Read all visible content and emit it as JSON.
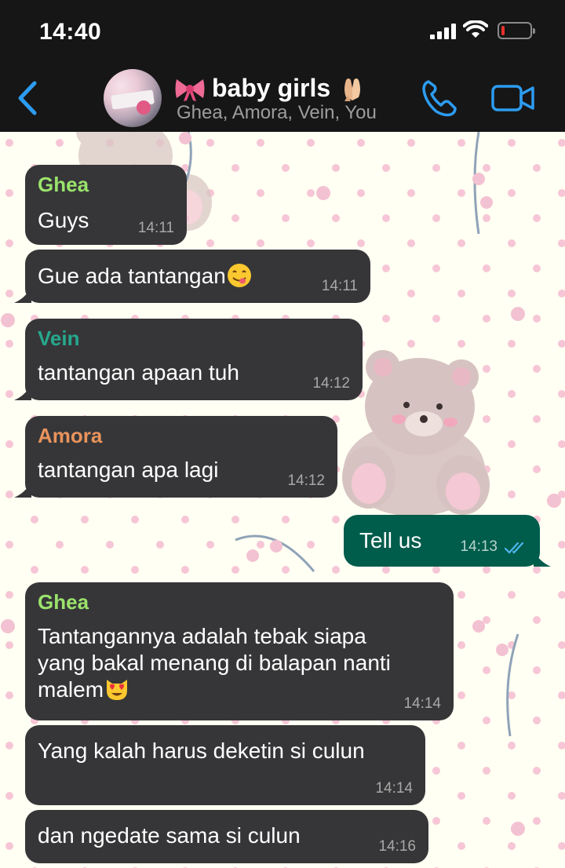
{
  "status_bar": {
    "time": "14:40",
    "battery_level": 0.1
  },
  "header": {
    "back_icon": "chevron-left-icon",
    "group_name": "baby girls",
    "title_icons": [
      "pink-bow-emoji",
      "praying-hands-emoji"
    ],
    "members": "Ghea, Amora, Vein, You",
    "call_icon": "phone-icon",
    "video_icon": "video-camera-icon"
  },
  "colors": {
    "header_bg": "#161616",
    "incoming_bubble": "#363638",
    "outgoing_bubble": "#005c4b",
    "accent_blue": "#2d9cf0",
    "sender_ghea": "#9be36c",
    "sender_vein": "#26a88d",
    "sender_amora": "#e8935c"
  },
  "messages": [
    {
      "sender": "Ghea",
      "text": "Guys",
      "time": "14:11",
      "direction": "in"
    },
    {
      "sender": "",
      "text": "Gue ada tantangan",
      "emoji": "yum-face-emoji",
      "time": "14:11",
      "direction": "in"
    },
    {
      "sender": "Vein",
      "text": "tantangan apaan tuh",
      "time": "14:12",
      "direction": "in"
    },
    {
      "sender": "Amora",
      "text": "tantangan apa lagi",
      "time": "14:12",
      "direction": "in"
    },
    {
      "sender": "",
      "text": "Tell us",
      "time": "14:13",
      "direction": "out",
      "status": "read-double-tick-icon"
    },
    {
      "sender": "Ghea",
      "lines": [
        "Tantangannya adalah tebak siapa",
        "yang bakal menang di balapan nanti",
        "malem"
      ],
      "emoji": "heart-eyes-cat-emoji",
      "time": "14:14",
      "direction": "in"
    },
    {
      "sender": "",
      "text": "Yang kalah harus deketin si culun",
      "time": "14:14",
      "direction": "in"
    },
    {
      "sender": "",
      "text": "dan ngedate sama si culun",
      "time": "14:16",
      "direction": "in"
    }
  ]
}
